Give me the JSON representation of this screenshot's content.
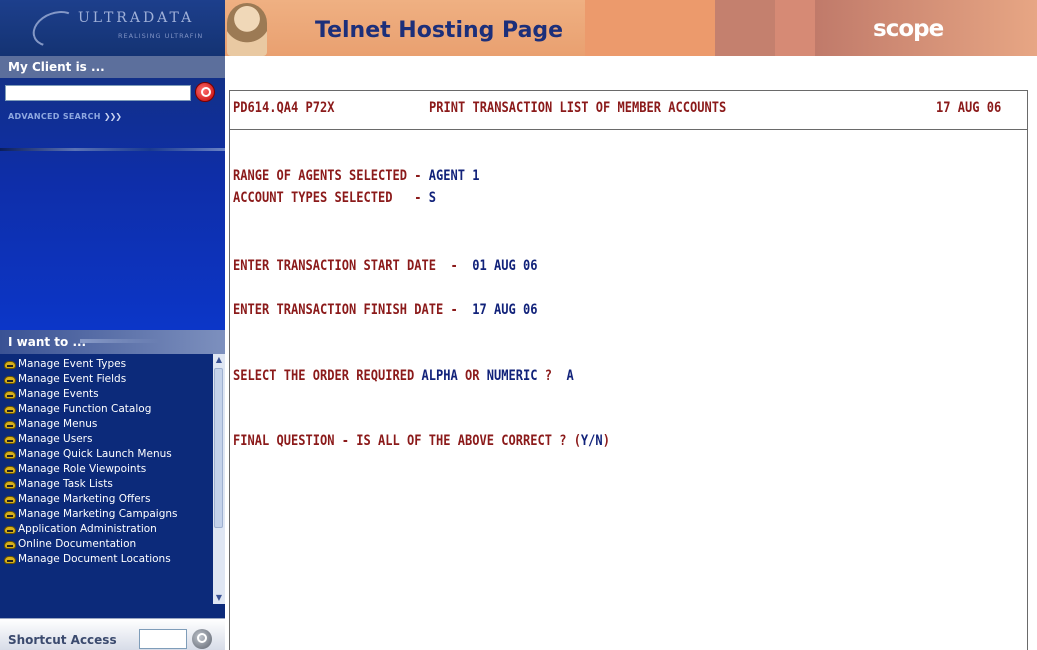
{
  "sidebar": {
    "logo": {
      "name": "ULTRADATA",
      "tagline": "REALISING ULTRAFIN"
    },
    "client": {
      "heading": "My Client is ...",
      "search_value": "",
      "advanced_search": "ADVANCED SEARCH",
      "advanced_chevrons": "❯❯❯"
    },
    "want": {
      "heading": "I want to ...",
      "items": [
        "Manage Event Types",
        "Manage Event Fields",
        "Manage Events",
        "Manage Function Catalog",
        "Manage Menus",
        "Manage Users",
        "Manage Quick Launch Menus",
        "Manage Role Viewpoints",
        "Manage Task Lists",
        "Manage Marketing Offers",
        "Manage Marketing Campaigns",
        "Application Administration",
        "Online Documentation",
        "Manage Document Locations"
      ]
    },
    "shortcut": {
      "label": "Shortcut Access",
      "value": ""
    }
  },
  "header": {
    "title": "Telnet Hosting Page",
    "brand": "scope"
  },
  "terminal": {
    "program_id": "PD614.QA4 P72X",
    "screen_title": "PRINT TRANSACTION LIST OF MEMBER ACCOUNTS",
    "date": "17 AUG 06",
    "agents_label": "RANGE OF AGENTS SELECTED - ",
    "agents_value": "AGENT 1",
    "types_label": "ACCOUNT TYPES SELECTED   - ",
    "types_value": "S",
    "start_label": "ENTER TRANSACTION START DATE  -  ",
    "start_value": "01 AUG 06",
    "finish_label": "ENTER TRANSACTION FINISH DATE -  ",
    "finish_value": "17 AUG 06",
    "order_label": "SELECT THE ORDER REQUIRED ",
    "order_alpha": "ALPHA",
    "order_or": " OR ",
    "order_numeric": "NUMERIC",
    "order_q": " ?  ",
    "order_value": "A",
    "final_label": "FINAL QUESTION - IS ALL OF THE ABOVE CORRECT ? (",
    "final_yn": "Y/N",
    "final_close": ")"
  },
  "colors": {
    "terminal_red": "#8b1a1a",
    "terminal_blue": "#11227a",
    "sidebar_blue": "#0c2a7a",
    "header_orange": "#eaa172"
  },
  "icons": {
    "client_search": "magnifier-icon",
    "shortcut_search": "magnifier-icon",
    "menu_bullet": "helmet-icon"
  }
}
